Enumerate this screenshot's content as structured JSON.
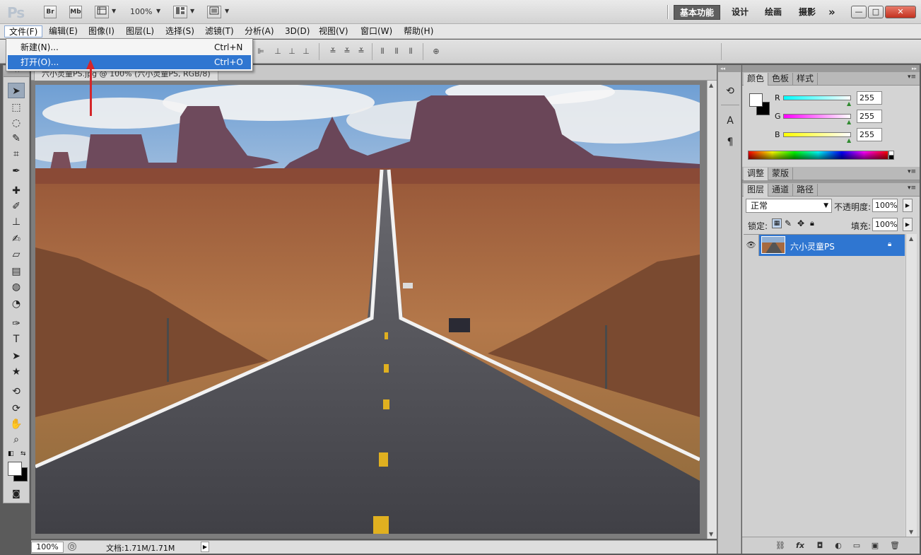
{
  "app": {
    "logo": "Ps",
    "bridge_label": "Br",
    "minibridge_label": "Mb",
    "zoom_display": "100%"
  },
  "workspaces": {
    "active": "基本功能",
    "items": [
      "设计",
      "绘画",
      "摄影"
    ],
    "more": "»"
  },
  "window_controls": {
    "minimize": "—",
    "restore": "□",
    "close": "✕"
  },
  "menubar": {
    "items": [
      "文件(F)",
      "编辑(E)",
      "图像(I)",
      "图层(L)",
      "选择(S)",
      "滤镜(T)",
      "分析(A)",
      "3D(D)",
      "视图(V)",
      "窗口(W)",
      "帮助(H)"
    ]
  },
  "file_menu": {
    "items": [
      {
        "label": "新建(N)...",
        "shortcut": "Ctrl+N"
      },
      {
        "label": "打开(O)...",
        "shortcut": "Ctrl+O"
      }
    ]
  },
  "document": {
    "tab_title": "六小灵童PS.jpg @ 100% (六小灵童PS, RGB/8)",
    "status_zoom": "100%",
    "status_info": "文档:1.71M/1.71M"
  },
  "color_panel": {
    "tabs": [
      "颜色",
      "色板",
      "样式"
    ],
    "channels": [
      {
        "name": "R",
        "value": "255",
        "color": "#00e0e0"
      },
      {
        "name": "G",
        "value": "255",
        "color": "#e000e0"
      },
      {
        "name": "B",
        "value": "255",
        "color": "#e0e000"
      }
    ]
  },
  "adjust_panel": {
    "tabs": [
      "调整",
      "蒙版"
    ]
  },
  "layers_panel": {
    "tabs": [
      "图层",
      "通道",
      "路径"
    ],
    "blend_mode": "正常",
    "opacity_label": "不透明度:",
    "opacity_value": "100%",
    "lock_label": "锁定:",
    "fill_label": "填充:",
    "fill_value": "100%",
    "layers": [
      {
        "name": "六小灵童PS",
        "locked": true,
        "visible": true
      }
    ]
  },
  "colors": {
    "accent": "#2f76d1",
    "arrow": "#d4262a"
  }
}
